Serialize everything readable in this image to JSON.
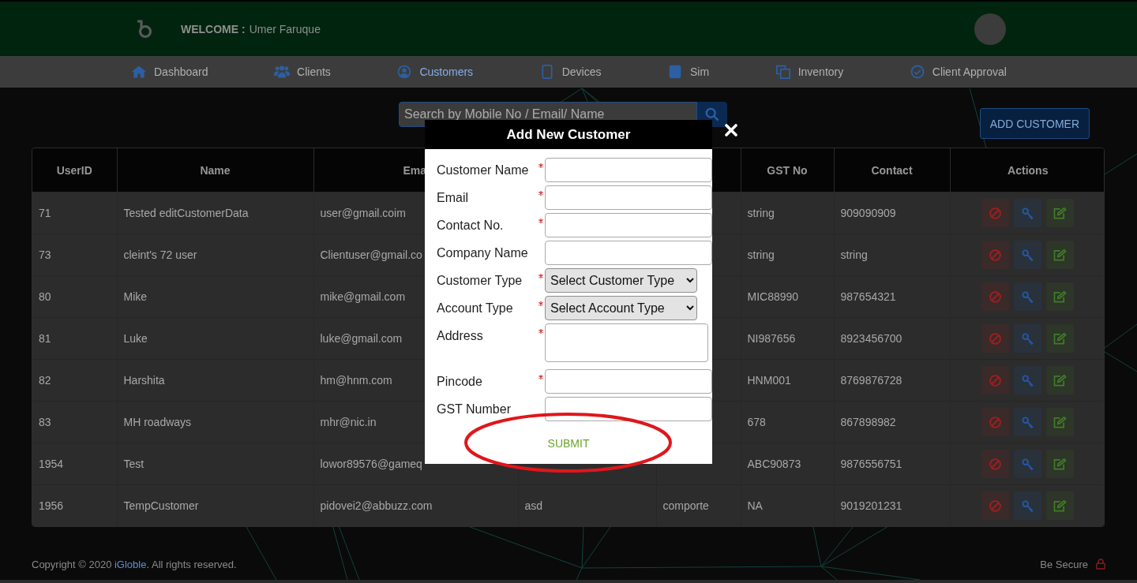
{
  "header": {
    "welcome_label": "WELCOME :",
    "user_name": "Umer Faruque"
  },
  "nav": [
    {
      "label": "Dashboard",
      "selected": false
    },
    {
      "label": "Clients",
      "selected": false
    },
    {
      "label": "Customers",
      "selected": true
    },
    {
      "label": "Devices",
      "selected": false
    },
    {
      "label": "Sim",
      "selected": false
    },
    {
      "label": "Inventory",
      "selected": false
    },
    {
      "label": "Client Approval",
      "selected": false
    }
  ],
  "search": {
    "placeholder": "Search by Mobile No / Email/ Name"
  },
  "add_button": "ADD CUSTOMER",
  "table": {
    "columns": {
      "user_id": "UserID",
      "name": "Name",
      "email": "Ema",
      "gst_no": "GST No",
      "contact": "Contact",
      "actions": "Actions"
    },
    "rows": [
      {
        "user_id": "71",
        "name": "Tested editCustomerData",
        "email": "user@gmail.coim",
        "gst_no": "string",
        "contact": "909090909"
      },
      {
        "user_id": "73",
        "name": "cleint's 72 user",
        "email": "Clientuser@gmail.co",
        "gst_no": "string",
        "contact": "string"
      },
      {
        "user_id": "80",
        "name": "Mike",
        "email": "mike@gmail.com",
        "gst_no": "MIC88990",
        "contact": "987654321"
      },
      {
        "user_id": "81",
        "name": "Luke",
        "email": "luke@gmail.com",
        "gst_no": "NI987656",
        "contact": "8923456700"
      },
      {
        "user_id": "82",
        "name": "Harshita",
        "email": "hm@hnm.com",
        "gst_no": "HNM001",
        "contact": "8769876728"
      },
      {
        "user_id": "83",
        "name": "MH roadways",
        "email": "mhr@nic.in",
        "gst_no": "678",
        "contact": "867898982"
      },
      {
        "user_id": "1954",
        "name": "Test",
        "email": "lowor89576@gameq",
        "gst_no": "ABC90873",
        "contact": "9876556751"
      },
      {
        "user_id": "1956",
        "name": "TempCustomer",
        "email": "pidovei2@abbuzz.com",
        "column_4": "asd",
        "column_5": "comporte",
        "gst_no": "NA",
        "contact": "9019201231"
      }
    ]
  },
  "modal": {
    "title": "Add New Customer",
    "fields": [
      {
        "kind": "text",
        "label": "Customer Name",
        "required": true
      },
      {
        "kind": "text",
        "label": "Email",
        "required": true
      },
      {
        "kind": "text",
        "label": "Contact No.",
        "required": true
      },
      {
        "kind": "text",
        "label": "Company Name",
        "required": false
      },
      {
        "kind": "select",
        "label": "Customer Type",
        "required": true,
        "value": "Select Customer Type"
      },
      {
        "kind": "select",
        "label": "Account Type",
        "required": true,
        "value": "Select Account Type"
      },
      {
        "kind": "textarea",
        "label": "Address",
        "required": true
      },
      {
        "kind": "text",
        "label": "Pincode",
        "required": true
      },
      {
        "kind": "text",
        "label": "GST Number",
        "required": false
      }
    ],
    "submit": {
      "label": "SUBMIT",
      "highlighted": true
    }
  },
  "footer": {
    "copyright_prefix": "Copyright © 2020",
    "brand_link": "iGloble",
    "copyright_suffix": ". All rights reserved.",
    "secure_label": "Be Secure"
  }
}
